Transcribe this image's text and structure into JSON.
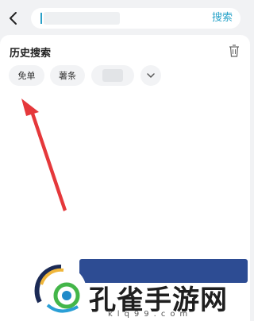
{
  "header": {
    "search_placeholder": "",
    "search_button_label": "搜索"
  },
  "history": {
    "title": "历史搜索",
    "chips": [
      {
        "label": "免单"
      },
      {
        "label": "薯条"
      },
      {
        "label": ""
      }
    ]
  },
  "watermark": {
    "text": "孔雀手游网",
    "url": "klq99.com"
  },
  "colors": {
    "accent": "#29a3c9",
    "annotation_arrow": "#e5383b",
    "background": "#f1f2f4"
  },
  "icons": [
    "back-arrow-icon",
    "trash-icon",
    "chevron-down-icon"
  ]
}
